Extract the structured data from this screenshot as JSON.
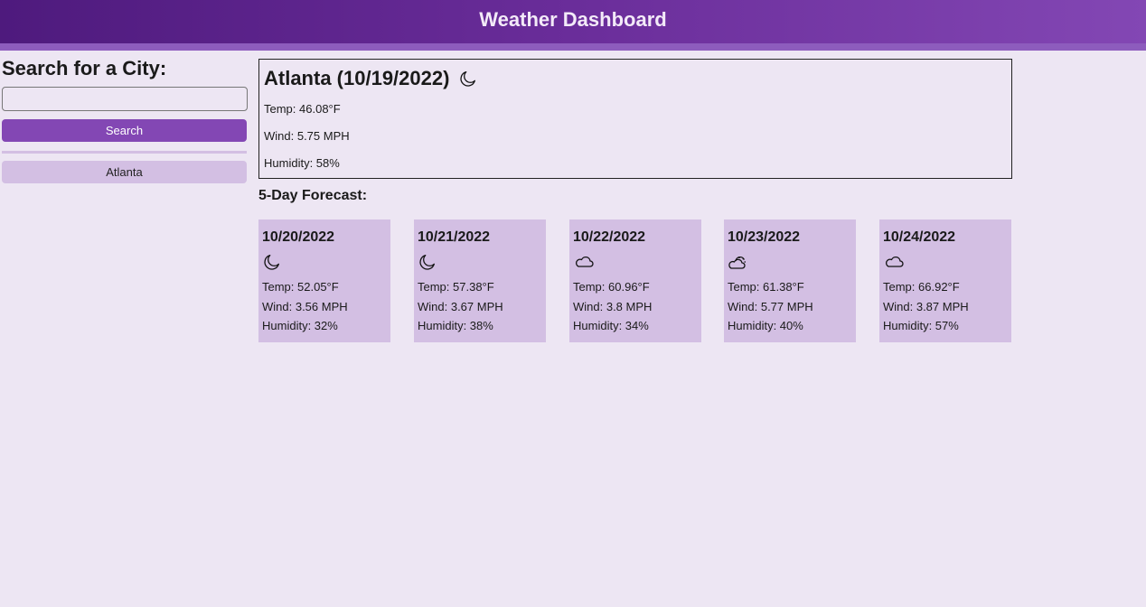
{
  "header": {
    "title": "Weather Dashboard"
  },
  "sidebar": {
    "heading": "Search for a City:",
    "search_value": "",
    "search_placeholder": "",
    "search_button": "Search",
    "history": [
      {
        "label": "Atlanta"
      }
    ]
  },
  "current": {
    "title": "Atlanta (10/19/2022)",
    "icon": "moon-icon",
    "temp": "Temp: 46.08°F",
    "wind": "Wind: 5.75 MPH",
    "humidity": "Humidity: 58%"
  },
  "forecast": {
    "heading": "5-Day Forecast:",
    "days": [
      {
        "date": "10/20/2022",
        "icon": "moon-icon",
        "temp": "Temp: 52.05°F",
        "wind": "Wind: 3.56 MPH",
        "humidity": "Humidity: 32%"
      },
      {
        "date": "10/21/2022",
        "icon": "moon-icon",
        "temp": "Temp: 57.38°F",
        "wind": "Wind: 3.67 MPH",
        "humidity": "Humidity: 38%"
      },
      {
        "date": "10/22/2022",
        "icon": "cloud-icon",
        "temp": "Temp: 60.96°F",
        "wind": "Wind: 3.8 MPH",
        "humidity": "Humidity: 34%"
      },
      {
        "date": "10/23/2022",
        "icon": "partly-cloudy-icon",
        "temp": "Temp: 61.38°F",
        "wind": "Wind: 5.77 MPH",
        "humidity": "Humidity: 40%"
      },
      {
        "date": "10/24/2022",
        "icon": "cloud-icon",
        "temp": "Temp: 66.92°F",
        "wind": "Wind: 3.87 MPH",
        "humidity": "Humidity: 57%"
      }
    ]
  },
  "colors": {
    "accent": "#8347b4",
    "card_bg": "#d3bfe3",
    "page_bg": "#ede6f3",
    "header_dark": "#4e1a7d"
  }
}
